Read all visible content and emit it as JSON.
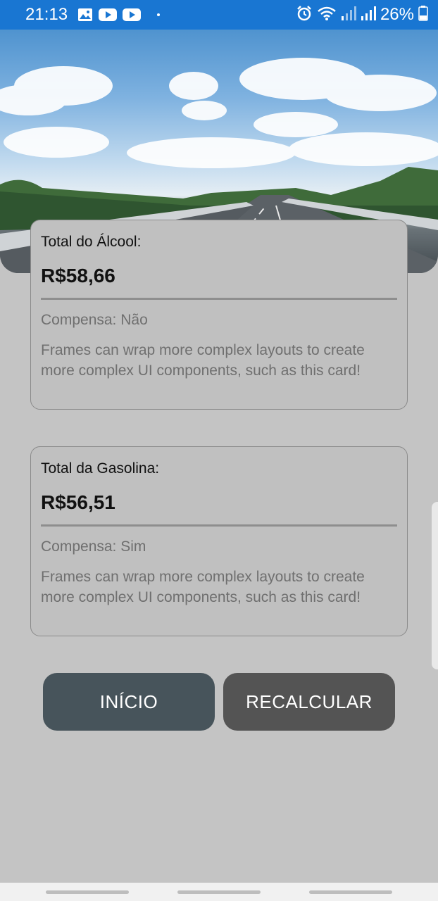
{
  "status_bar": {
    "time": "21:13",
    "battery": "26%",
    "icons": [
      "image-icon",
      "youtube-icon",
      "youtube-icon",
      "dot-icon",
      "alarm-icon",
      "wifi-icon",
      "signal-icon",
      "signal-icon",
      "battery-icon"
    ]
  },
  "header": {
    "image": "highway-sky-image"
  },
  "cards": [
    {
      "title": "Total do Álcool:",
      "value": "R$58,66",
      "status": "Compensa: Não",
      "description": "Frames can wrap more complex layouts to create more complex UI components, such as this card!"
    },
    {
      "title": "Total da Gasolina:",
      "value": "R$56,51",
      "status": "Compensa: Sim",
      "description": "Frames can wrap more complex layouts to create more complex UI components, such as this card!"
    }
  ],
  "buttons": {
    "inicio": "INÍCIO",
    "recalcular": "RECALCULAR"
  },
  "colors": {
    "status_bar": "#1976d2",
    "background": "#c4c4c4",
    "button_inicio": "#47545b",
    "button_recalcular": "#545454"
  }
}
